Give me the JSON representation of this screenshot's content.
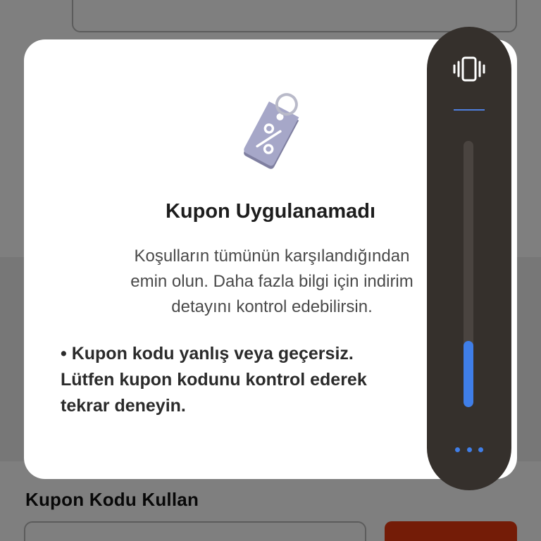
{
  "background": {
    "section_title": "Kupon Kodu Kullan",
    "apply_button_color": "#e8390e"
  },
  "dialog": {
    "icon": "discount-tag-icon",
    "title": "Kupon Uygulanamadı",
    "description_lines": [
      "Koşulların tümünün karşılandığından",
      "emin olun. Daha fazla bilgi için indirim",
      "detayını kontrol edebilirsin."
    ],
    "bullet_lines": [
      "• Kupon kodu yanlış veya geçersiz.",
      "Lütfen kupon kodunu kontrol ederek",
      "tekrar deneyin."
    ]
  },
  "volume_panel": {
    "mode_icon": "vibrate-icon",
    "level": 0.25,
    "accent_color": "#3f7ee8",
    "more_icon": "more-options-icon"
  }
}
